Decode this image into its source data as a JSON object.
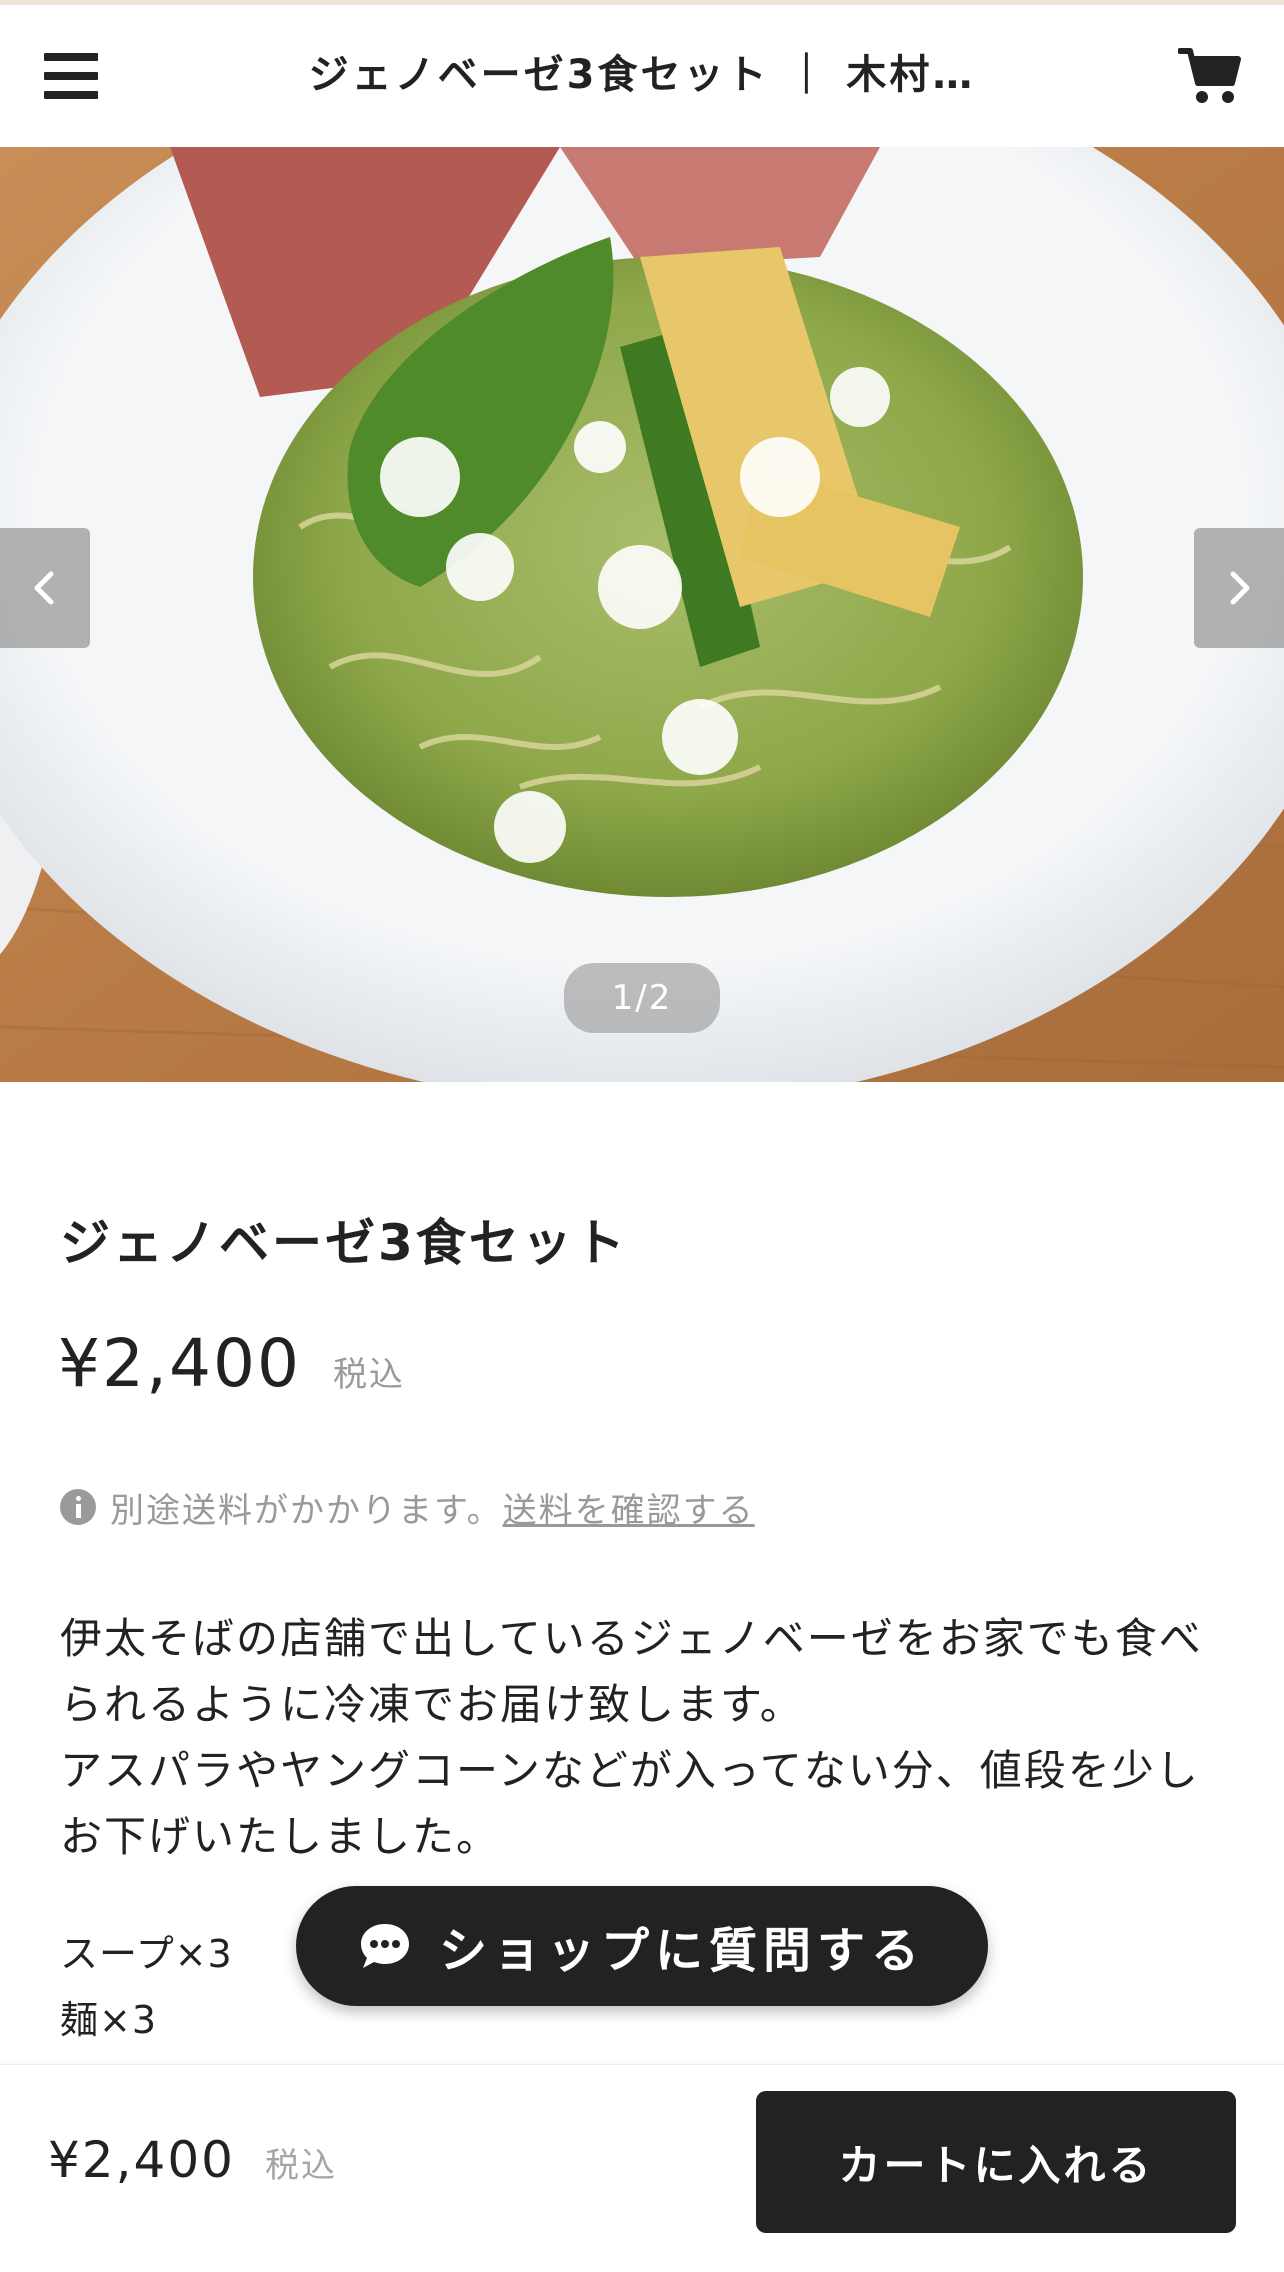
{
  "header": {
    "title": "ジェノベーゼ3食セット ｜ 木村…"
  },
  "carousel": {
    "counter": "1/2"
  },
  "product": {
    "title": "ジェノベーゼ3食セット",
    "price": "¥2,400",
    "tax_label": "税込"
  },
  "shipping": {
    "note": "別途送料がかかります。",
    "link": "送料を確認する"
  },
  "description": {
    "lines": [
      "伊太そばの店舗で出しているジェノベーゼをお家でも食べられるように冷凍でお届け致します。",
      "アスパラやヤングコーンなどが入ってない分、値段を少しお下げいたしました。"
    ]
  },
  "contents": {
    "items": [
      "スープ×3",
      "麺×3"
    ]
  },
  "ask_button": {
    "label": "ショップに質問する"
  },
  "bottom_bar": {
    "price": "¥2,400",
    "tax_label": "税込",
    "add_to_cart": "カートに入れる"
  },
  "colors": {
    "dark": "#222222",
    "muted": "#9a9a9a"
  }
}
